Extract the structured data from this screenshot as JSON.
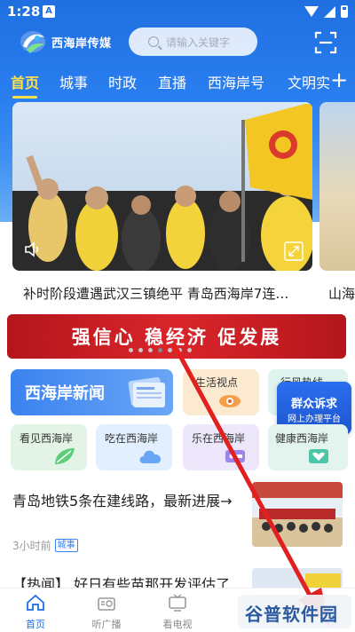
{
  "status_bar": {
    "time": "1:28",
    "notice": "A"
  },
  "header": {
    "brand": "西海岸传媒",
    "search_placeholder": "请输入关键字"
  },
  "tabs": [
    {
      "label": "首页",
      "active": true
    },
    {
      "label": "城事"
    },
    {
      "label": "时政"
    },
    {
      "label": "直播"
    },
    {
      "label": "西海岸号"
    },
    {
      "label": "文明实"
    }
  ],
  "hero": {
    "caption": "补时阶段遭遇武汉三镇绝平 青岛西海岸7连…",
    "next_caption": "山海"
  },
  "banner": {
    "text": "强信心 稳经济 促发展",
    "dots_count": 7,
    "active_dot": 3
  },
  "services": {
    "big": {
      "label": "西海岸新闻"
    },
    "items": [
      {
        "label": "生活视点"
      },
      {
        "label": "行风热线"
      },
      {
        "label": "看见西海岸"
      },
      {
        "label": "吃在西海岸"
      },
      {
        "label": "乐在西海岸"
      },
      {
        "label": "健康西海岸"
      }
    ],
    "float_badge": {
      "line1": "群众诉求",
      "line2": "网上办理平台"
    }
  },
  "news": [
    {
      "title": "青岛地铁5条在建线路，最新进展→",
      "time": "3小时前",
      "tag": "城事"
    },
    {
      "title": "【热闻】 好日有些苗那开发评估了"
    }
  ],
  "bottom_nav": [
    {
      "label": "首页",
      "active": true
    },
    {
      "label": "听广播"
    },
    {
      "label": "看电视"
    }
  ],
  "watermark": {
    "text": "谷普软件园"
  },
  "colors": {
    "primary": "#1f6fe0",
    "tab_active": "#ffe24a",
    "banner_red": "#c81e24",
    "arrow_red": "#e32020"
  }
}
